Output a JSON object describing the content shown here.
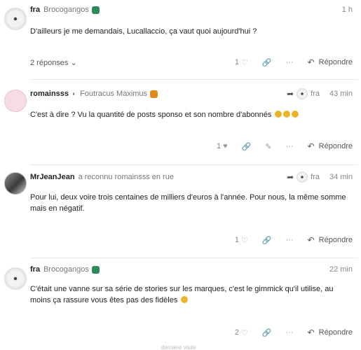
{
  "posts": [
    {
      "username": "fra",
      "title": "Brocogangos",
      "time": "1 h",
      "body": "D'ailleurs je me demandais, Lucallaccio, ça vaut quoi aujourd'hui ?",
      "replies": "2 réponses",
      "likes": "1",
      "reply_label": "Répondre"
    },
    {
      "username": "romainsss",
      "title": "Foutracus Maximus",
      "reply_to": "fra",
      "time": "43 min",
      "body": "C'est à dire ? Vu la quantité de posts sponso et son nombre d'abonnés",
      "likes": "1",
      "reply_label": "Répondre"
    },
    {
      "username": "MrJeanJean",
      "title": "a reconnu romainsss en rue",
      "reply_to": "fra",
      "time": "34 min",
      "body": "Pour lui, deux voire trois centaines de milliers d'euros à l'année. Pour nous, la même somme mais en négatif.",
      "likes": "1",
      "reply_label": "Répondre"
    },
    {
      "username": "fra",
      "title": "Brocogangos",
      "time": "22 min",
      "body": "C'était une vanne sur sa série de stories sur les marques, c'est le gimmick qu'il utilise, au moins ça rassure vous êtes pas des fidèles",
      "likes": "2",
      "reply_label": "Répondre"
    }
  ],
  "footer_hint": "dernière visite",
  "colors": {
    "accent_green": "#2e8b57",
    "accent_orange": "#e08a1e",
    "muted": "#888888"
  },
  "icons": [
    "heart-icon",
    "link-icon",
    "more-icon",
    "reply-icon",
    "chevron-down-icon",
    "edit-icon",
    "bookmark-icon",
    "shield-icon"
  ]
}
